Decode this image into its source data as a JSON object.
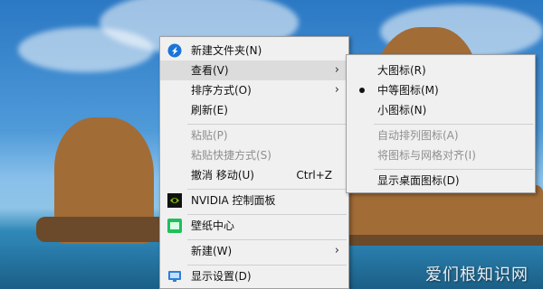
{
  "context_menu": {
    "items": [
      {
        "label": "新建文件夹(N)",
        "icon": "new-folder-icon"
      },
      {
        "label": "查看(V)"
      },
      {
        "label": "排序方式(O)"
      },
      {
        "label": "刷新(E)"
      },
      {
        "label": "粘贴(P)"
      },
      {
        "label": "粘贴快捷方式(S)"
      },
      {
        "label": "撤消 移动(U)",
        "shortcut": "Ctrl+Z"
      },
      {
        "label": "NVIDIA 控制面板",
        "icon": "nvidia-icon"
      },
      {
        "label": "壁纸中心",
        "icon": "wallpaper-icon"
      },
      {
        "label": "新建(W)"
      },
      {
        "label": "显示设置(D)",
        "icon": "display-icon"
      }
    ]
  },
  "view_submenu": {
    "items": [
      {
        "label": "大图标(R)"
      },
      {
        "label": "中等图标(M)",
        "checked": true
      },
      {
        "label": "小图标(N)"
      },
      {
        "label": "自动排列图标(A)"
      },
      {
        "label": "将图标与网格对齐(I)"
      },
      {
        "label": "显示桌面图标(D)"
      }
    ]
  },
  "watermark": "爱们根知识网",
  "colors": {
    "menu_bg": "#f0f0f0",
    "hover": "#dcdcdc",
    "disabled_text": "#8f8f8f"
  }
}
